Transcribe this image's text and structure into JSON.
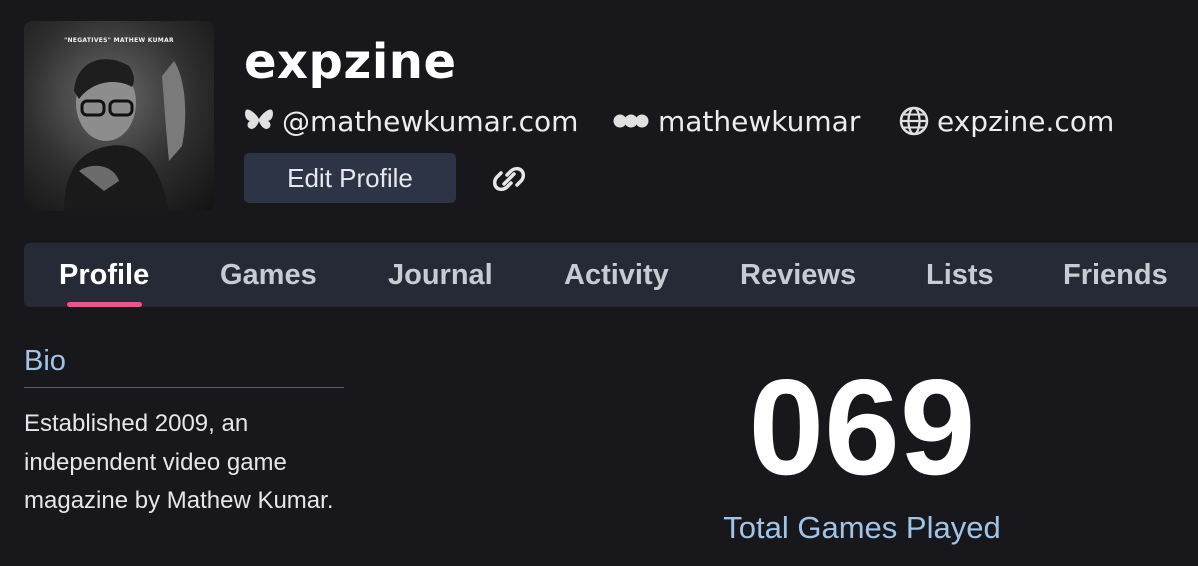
{
  "profile": {
    "avatar_caption": "\"NEGATIVES\" MATHEW KUMAR",
    "username": "expzine",
    "bluesky": "@mathewkumar.com",
    "mastodon": "mathewkumar",
    "website": "expzine.com",
    "edit_label": "Edit Profile"
  },
  "tabs": [
    {
      "label": "Profile",
      "active": true
    },
    {
      "label": "Games"
    },
    {
      "label": "Journal"
    },
    {
      "label": "Activity"
    },
    {
      "label": "Reviews"
    },
    {
      "label": "Lists"
    },
    {
      "label": "Friends"
    }
  ],
  "bio": {
    "title": "Bio",
    "text": "Established 2009, an independent video game magazine by Mathew Kumar."
  },
  "stats": {
    "total_games": "069",
    "total_games_label": "Total Games Played"
  },
  "colors": {
    "background": "#18181c",
    "tab_bar": "#262a36",
    "accent_pink": "#e05a8a",
    "accent_blue": "#9fc4e8",
    "button": "#2d3446"
  },
  "icons": {
    "bluesky": "butterfly-icon",
    "mastodon": "mastodon-icon",
    "website": "globe-icon",
    "share": "link-icon"
  }
}
